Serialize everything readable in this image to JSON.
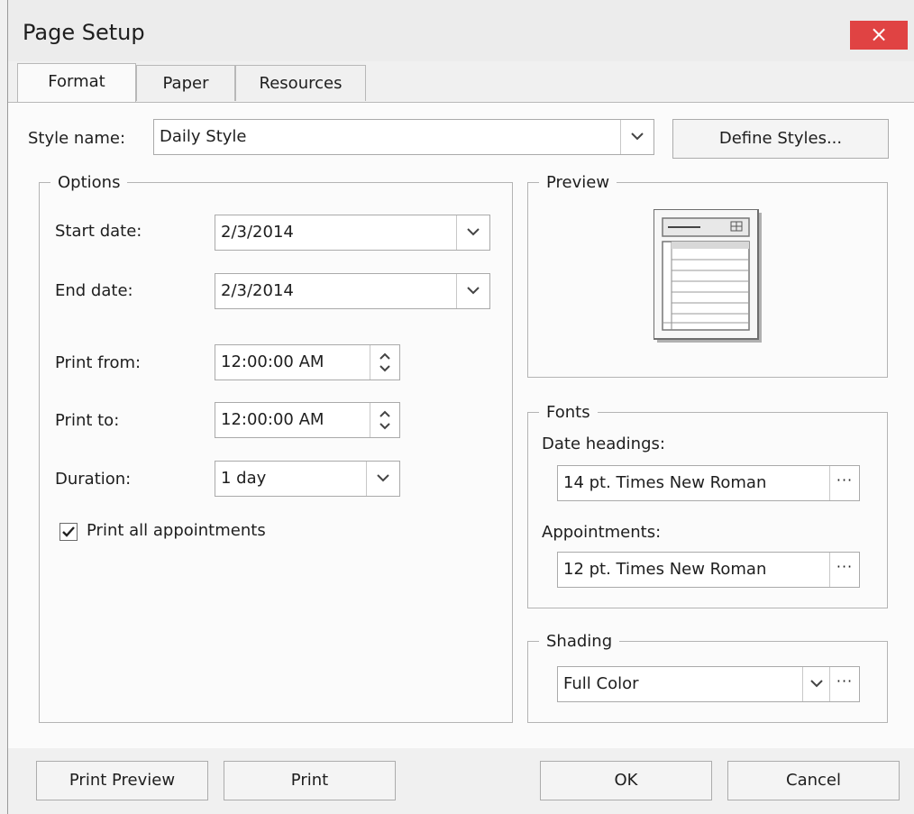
{
  "window": {
    "title": "Page Setup",
    "close_label": "×"
  },
  "tabs": [
    {
      "label": "Format",
      "active": true
    },
    {
      "label": "Paper",
      "active": false
    },
    {
      "label": "Resources",
      "active": false
    }
  ],
  "style_name": {
    "label": "Style name:",
    "value": "Daily Style",
    "define_styles_label": "Define Styles..."
  },
  "options": {
    "legend": "Options",
    "start_date": {
      "label": "Start date:",
      "value": "2/3/2014"
    },
    "end_date": {
      "label": "End date:",
      "value": "2/3/2014"
    },
    "print_from": {
      "label": "Print from:",
      "value": "12:00:00 AM"
    },
    "print_to": {
      "label": "Print to:",
      "value": "12:00:00 AM"
    },
    "duration": {
      "label": "Duration:",
      "value": "1 day"
    },
    "print_all_appointments": {
      "label": "Print all appointments",
      "checked": true
    }
  },
  "preview": {
    "legend": "Preview",
    "icon": "daily-calendar-page-icon"
  },
  "fonts": {
    "legend": "Fonts",
    "date_headings": {
      "label": "Date headings:",
      "value": "14 pt. Times New Roman"
    },
    "appointments": {
      "label": "Appointments:",
      "value": "12 pt. Times New Roman"
    }
  },
  "shading": {
    "legend": "Shading",
    "value": "Full Color"
  },
  "footer": {
    "print_preview_label": "Print Preview",
    "print_label": "Print",
    "ok_label": "OK",
    "cancel_label": "Cancel"
  },
  "colors": {
    "close_button": "#e04343",
    "panel_background": "#fbfbfb",
    "window_background": "#f0f0f0"
  },
  "ellipsis_label": "···"
}
